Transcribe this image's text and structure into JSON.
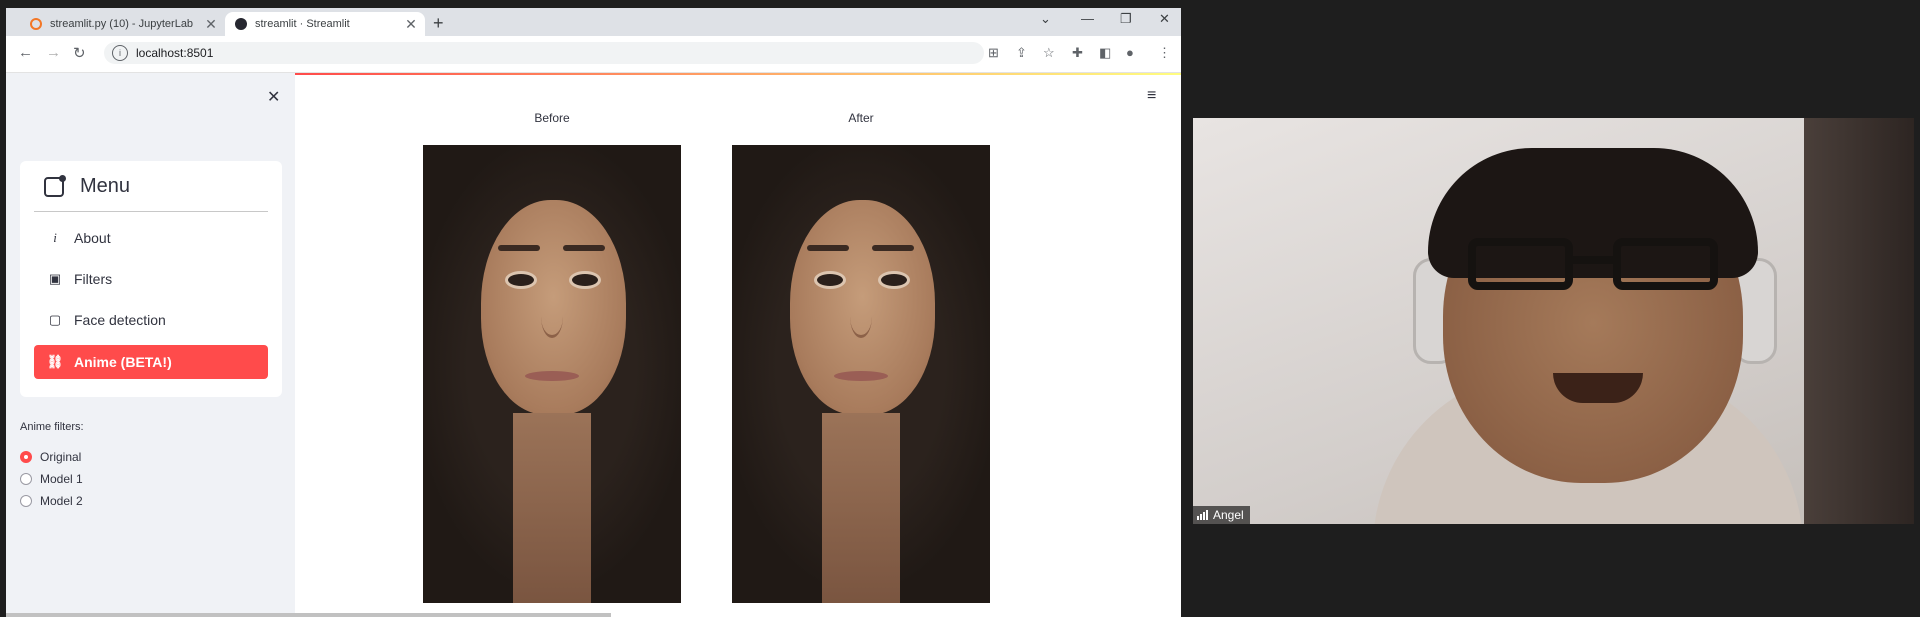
{
  "browser": {
    "tabs": [
      {
        "title": "streamlit.py (10) - JupyterLab",
        "favicon_color": "#f37726"
      },
      {
        "title": "streamlit · Streamlit",
        "favicon_color": "#262730"
      }
    ],
    "new_tab": "+",
    "url": "localhost:8501",
    "window_controls": {
      "minimize": "—",
      "restore": "❐",
      "close": "✕",
      "dropdown": "⌄"
    }
  },
  "sidebar": {
    "close_icon": "✕",
    "menu_title": "Menu",
    "menu_items": [
      {
        "label": "About",
        "icon": "i"
      },
      {
        "label": "Filters",
        "icon": "▣"
      },
      {
        "label": "Face detection",
        "icon": "▢"
      },
      {
        "label": "Anime (BETA!)",
        "icon": "🔗"
      }
    ],
    "active_index": 3,
    "filters_label": "Anime filters:",
    "radio_options": [
      {
        "label": "Original",
        "selected": true
      },
      {
        "label": "Model 1",
        "selected": false
      },
      {
        "label": "Model 2",
        "selected": false
      }
    ]
  },
  "main": {
    "hamburger_icon": "≡",
    "before_caption": "Before",
    "after_caption": "After"
  },
  "video": {
    "participant_name": "Angel"
  },
  "colors": {
    "accent": "#ff4b4b",
    "sidebar_bg": "#f0f2f6"
  }
}
